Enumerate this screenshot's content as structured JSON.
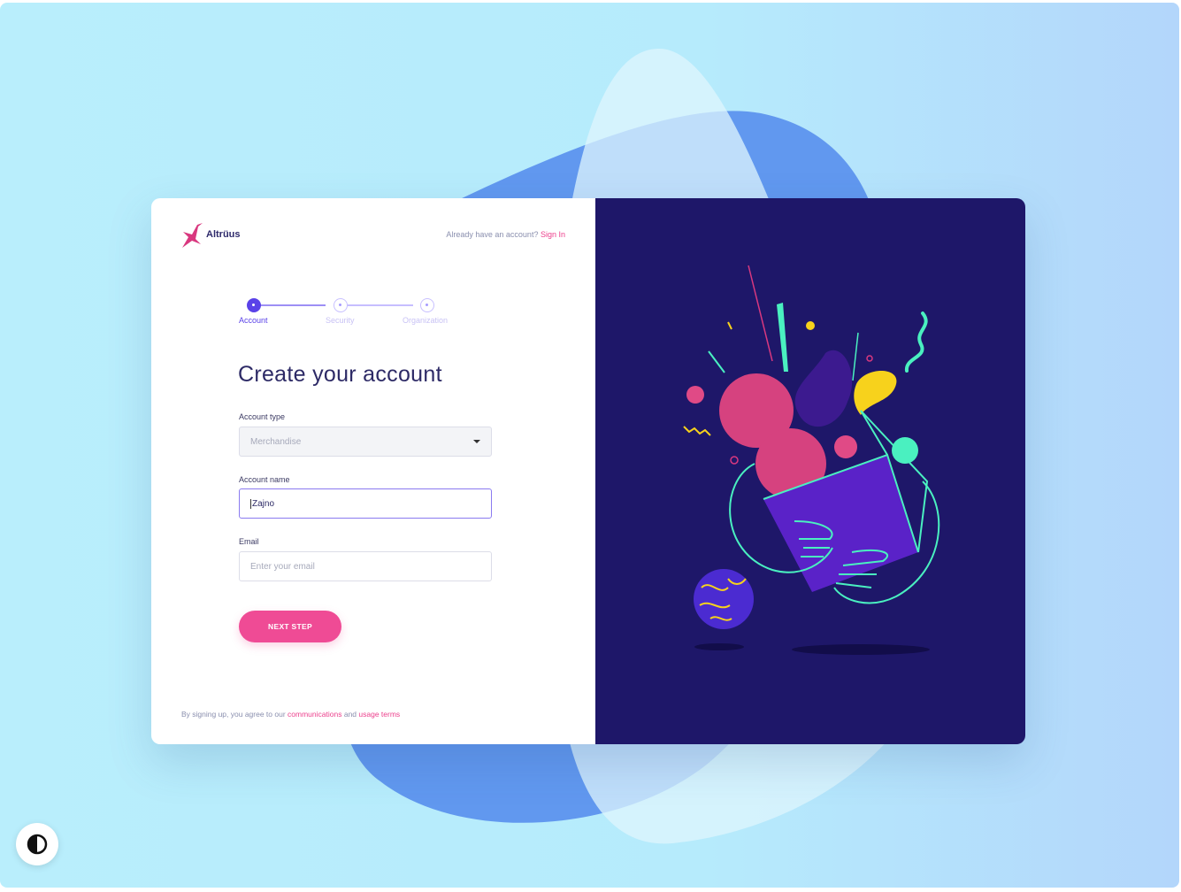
{
  "brand": {
    "name": "Altrüus"
  },
  "header": {
    "prompt": "Already have an account?",
    "signin_link": "Sign In"
  },
  "steps": [
    {
      "label": "Account",
      "active": true
    },
    {
      "label": "Security",
      "active": false
    },
    {
      "label": "Organization",
      "active": false
    }
  ],
  "form": {
    "title": "Create your account",
    "account_type": {
      "label": "Account type",
      "value": "Merchandise"
    },
    "account_name": {
      "label": "Account name",
      "value": "Zajno"
    },
    "email": {
      "label": "Email",
      "placeholder": "Enter your email",
      "value": ""
    },
    "next_button": "NEXT STEP"
  },
  "footer": {
    "prefix": "By signing up, you agree to our",
    "link1": "communications",
    "middle": "and",
    "link2": "usage terms"
  },
  "colors": {
    "accent": "#5a42e8",
    "pink": "#ef4b95",
    "panel": "#1e1769"
  }
}
